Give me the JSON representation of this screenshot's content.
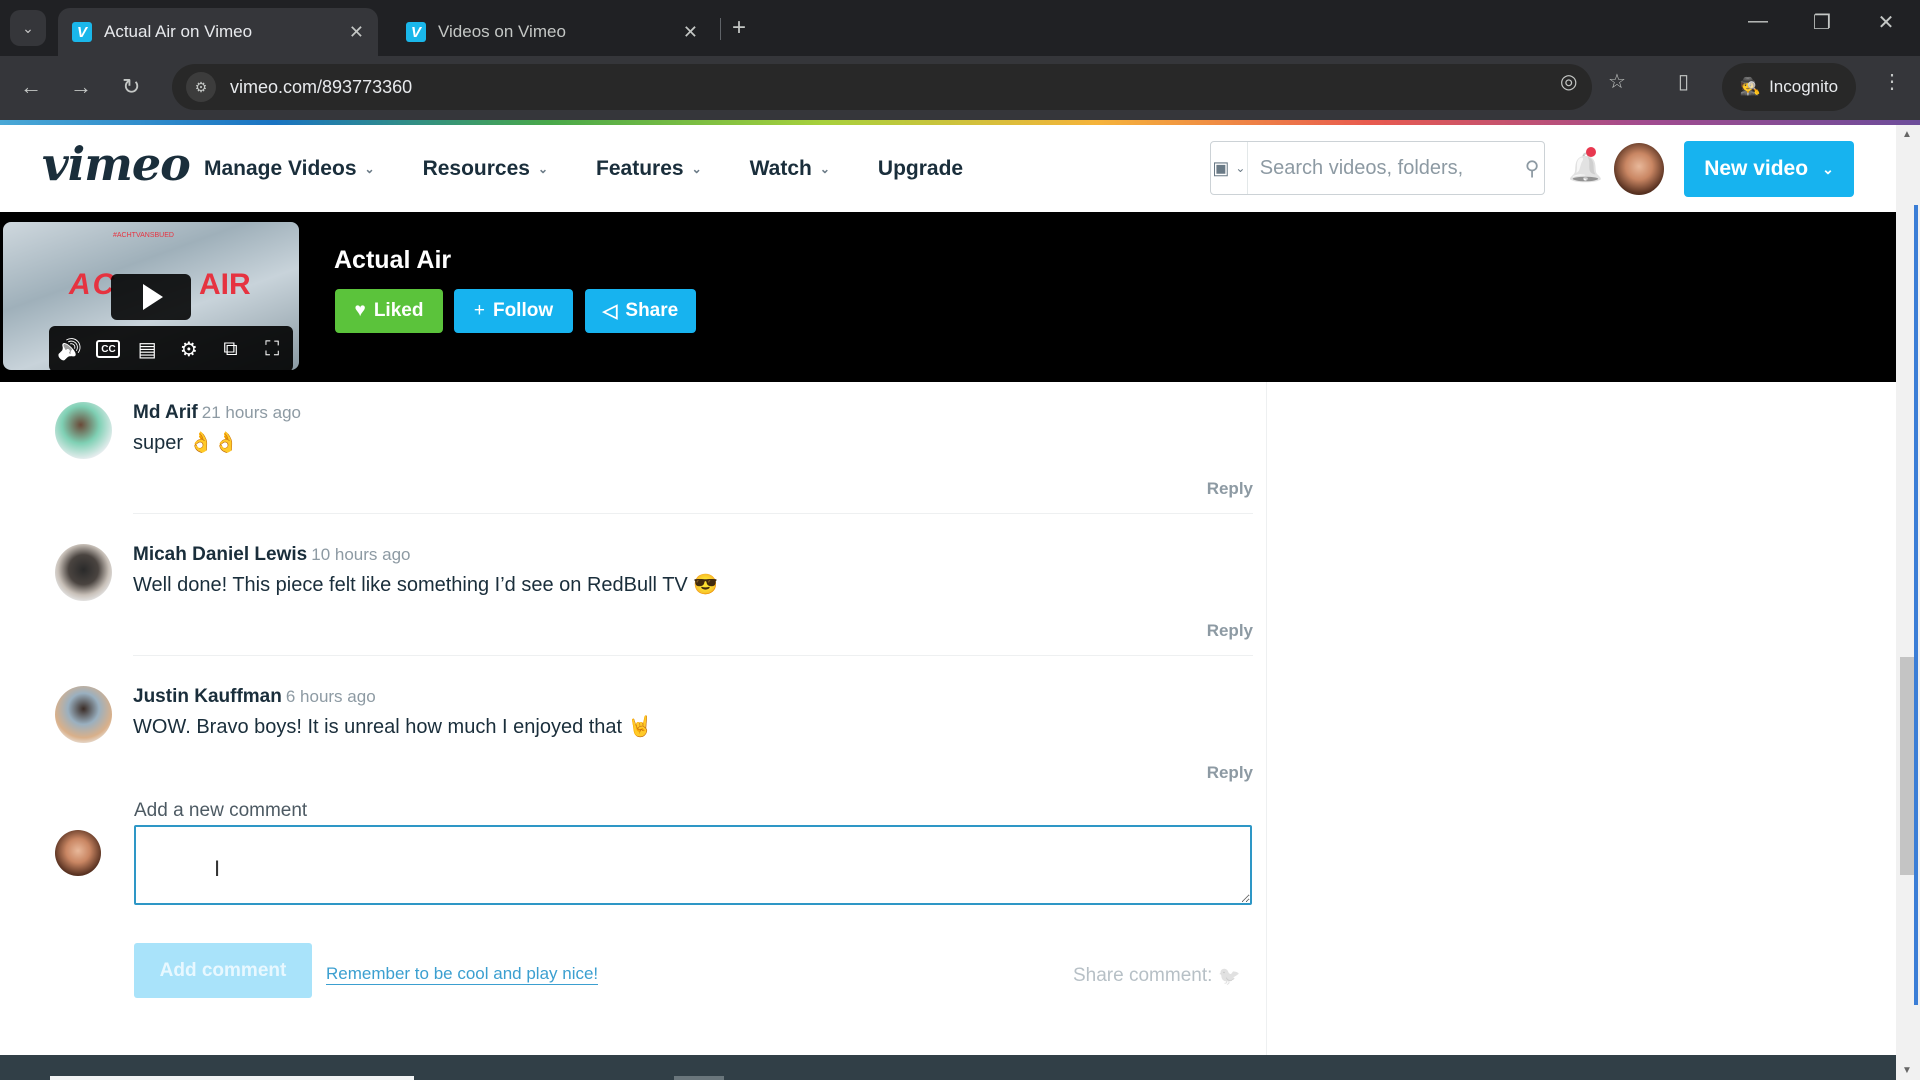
{
  "browser": {
    "tabs": [
      {
        "title": "Actual Air on Vimeo",
        "active": true,
        "favicon": "V"
      },
      {
        "title": "Videos on Vimeo",
        "active": false,
        "favicon": "V"
      }
    ],
    "url": "vimeo.com/893773360",
    "incognito_label": "Incognito",
    "icons": {
      "tab_search": "⌄",
      "close": "✕",
      "new_tab": "+",
      "minimize": "—",
      "restore": "❐",
      "window_close": "✕",
      "back": "←",
      "forward": "→",
      "reload": "↻",
      "site_info": "⚙",
      "eye_off": "◎",
      "star": "☆",
      "side_panel": "▯",
      "incognito": "🕵",
      "menu": "⋮"
    }
  },
  "header": {
    "logo": "vimeo",
    "nav": [
      {
        "label": "Manage Videos",
        "has_dropdown": true
      },
      {
        "label": "Resources",
        "has_dropdown": true
      },
      {
        "label": "Features",
        "has_dropdown": true
      },
      {
        "label": "Watch",
        "has_dropdown": true
      },
      {
        "label": "Upgrade",
        "has_dropdown": false
      }
    ],
    "search_placeholder": "Search videos, folders,",
    "new_video_label": "New video",
    "icons": {
      "chevron": "⌄",
      "search": "⚲",
      "bell": "🔔",
      "scope": "▣"
    }
  },
  "video": {
    "title": "Actual Air",
    "thumbnail_text_left": "AC",
    "thumbnail_text_right": "AIR",
    "thumbnail_small_text": "#ACHTVANSBUED",
    "buttons": {
      "liked": "Liked",
      "follow": "Follow",
      "share": "Share"
    },
    "icons": {
      "heart": "♥",
      "plus": "+",
      "share": "◁",
      "volume": "🔊",
      "cc": "CC",
      "transcript": "▤",
      "settings": "⚙",
      "pip": "⧉",
      "fullscreen": "⛶"
    }
  },
  "comments": [
    {
      "author": "Md Arif",
      "time": "21 hours ago",
      "text": "super ",
      "emoji": "👌👌",
      "reply_label": "Reply"
    },
    {
      "author": "Micah Daniel Lewis",
      "time": "10 hours ago",
      "text": "Well done! This piece felt like something I’d see on RedBull TV ",
      "emoji": "😎",
      "reply_label": "Reply"
    },
    {
      "author": "Justin Kauffman",
      "time": "6 hours ago",
      "text": "WOW. Bravo boys! It is unreal how much I enjoyed that ",
      "emoji": "🤘",
      "reply_label": "Reply"
    }
  ],
  "new_comment": {
    "label": "Add a new comment",
    "value": "",
    "submit_label": "Add comment",
    "guideline_link": "Remember to be cool and play nice!",
    "share_label": "Share comment:",
    "share_icon": "🐦",
    "cursor_icon": "I"
  }
}
